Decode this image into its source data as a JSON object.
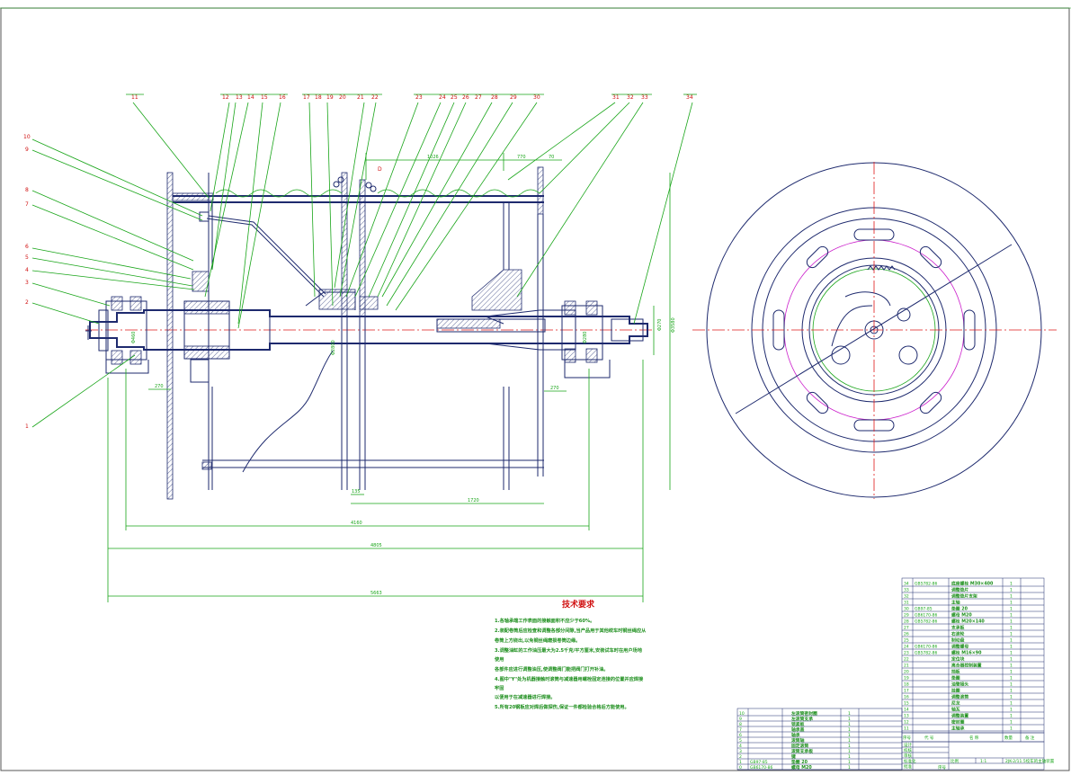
{
  "part_labels": [
    "1",
    "2",
    "3",
    "4",
    "5",
    "6",
    "7",
    "8",
    "9",
    "10",
    "11",
    "12",
    "13",
    "14",
    "15",
    "16",
    "17",
    "18",
    "19",
    "20",
    "21",
    "22",
    "23",
    "24",
    "25",
    "26",
    "27",
    "28",
    "29",
    "30",
    "31",
    "32",
    "33",
    "34"
  ],
  "dimensions": {
    "d_1026": "1026",
    "d_770": "770",
    "d_70": "70",
    "d_270": "270",
    "d_1720": "1720",
    "d_4160": "4160",
    "d_4805": "4805",
    "d_5663": "5663",
    "d_135": "135",
    "phi_3580": "Φ3580",
    "phi_270": "Φ270",
    "phi_2800": "Φ2800",
    "phi_280": "Φ280",
    "phi_460": "Φ460",
    "note_D": "D"
  },
  "tech": {
    "title": "技术要求",
    "lines": [
      "1.各轴承端工作表面的接触面积不应少于60%。",
      "2.装配卷筒后应检查和调整各部分间隙,当产品用于其他绞车时钢丝绳应从",
      "  卷筒上方绕出,以免钢丝绳磨损卷筒边缘。",
      "3.调整油缸的工作油压最大为2.5千克/平方厘米,安装试车时在用户场地",
      "  使用",
      "  各部件应进行调整油压,使调整阀门能把阀门打开补油。",
      "4.图中\"Y\"处为机器接触时滚筒与减速器用螺栓固定连接的位置并应焊接",
      "  牢固",
      "  以便用于在减速器进行焊接。",
      "5.所有20钢板应对焊后做探伤,保证一件都检验合格后方能使用。"
    ]
  },
  "bom_right": [
    {
      "no": "34",
      "std": "GB5782-86",
      "name": "底座螺栓 M30×400",
      "qty": "1"
    },
    {
      "no": "33",
      "std": "",
      "name": "调整垫片",
      "qty": "1"
    },
    {
      "no": "32",
      "std": "",
      "name": "调整垫片支架",
      "qty": "1"
    },
    {
      "no": "31",
      "std": "",
      "name": "主轴",
      "qty": "1"
    },
    {
      "no": "30",
      "std": "GB97-85",
      "name": "垫圈 20",
      "qty": "1"
    },
    {
      "no": "29",
      "std": "GB6170-86",
      "name": "螺母 M20",
      "qty": "1"
    },
    {
      "no": "28",
      "std": "GB5782-86",
      "name": "螺栓 M20×140",
      "qty": "1"
    },
    {
      "no": "27",
      "std": "",
      "name": "支承板",
      "qty": "1"
    },
    {
      "no": "26",
      "std": "",
      "name": "右滚轮",
      "qty": "1"
    },
    {
      "no": "25",
      "std": "",
      "name": "制动盘",
      "qty": "1"
    },
    {
      "no": "24",
      "std": "GB6170-86",
      "name": "调整螺母",
      "qty": "1"
    },
    {
      "no": "23",
      "std": "GB5782-86",
      "name": "螺栓 M16×90",
      "qty": "1"
    },
    {
      "no": "22",
      "std": "",
      "name": "定位块",
      "qty": "1"
    },
    {
      "no": "21",
      "std": "",
      "name": "离合器控制装置",
      "qty": "1"
    },
    {
      "no": "20",
      "std": "",
      "name": "挡板",
      "qty": "1"
    },
    {
      "no": "19",
      "std": "",
      "name": "垫圈",
      "qty": "1"
    },
    {
      "no": "18",
      "std": "",
      "name": "油管接头",
      "qty": "1"
    },
    {
      "no": "17",
      "std": "",
      "name": "挂圈",
      "qty": "1"
    },
    {
      "no": "16",
      "std": "",
      "name": "调整滚筒",
      "qty": "1"
    },
    {
      "no": "15",
      "std": "",
      "name": "尼龙",
      "qty": "1"
    },
    {
      "no": "14",
      "std": "",
      "name": "轴瓦",
      "qty": "1"
    },
    {
      "no": "13",
      "std": "",
      "name": "调整装置",
      "qty": "1"
    },
    {
      "no": "12",
      "std": "",
      "name": "密封圈",
      "qty": "1"
    },
    {
      "no": "11",
      "std": "",
      "name": "主轴承",
      "qty": "1"
    }
  ],
  "bom_right_header": {
    "no": "序号",
    "code": "代 号",
    "name": "名 称",
    "qty": "数量",
    "note": "备 注"
  },
  "title_block": {
    "scale_label": "比例",
    "scale_value": "1:1",
    "drawing_title": "2JK-2/11.5绞车的主轴装置",
    "rows": [
      "设计",
      "校核",
      "审核",
      "标准化",
      "批准"
    ],
    "seq_label": "序号"
  },
  "bom_left": [
    {
      "no": "10",
      "std": "",
      "name": "左滚筒密封圈",
      "qty": "1"
    },
    {
      "no": "9",
      "std": "",
      "name": "左滚筒支承",
      "qty": "1"
    },
    {
      "no": "8",
      "std": "",
      "name": "锁紧板",
      "qty": "1"
    },
    {
      "no": "7",
      "std": "",
      "name": "轴承盖",
      "qty": "1"
    },
    {
      "no": "6",
      "std": "",
      "name": "轴承",
      "qty": "1"
    },
    {
      "no": "5",
      "std": "",
      "name": "滚筒轴",
      "qty": "1"
    },
    {
      "no": "4",
      "std": "",
      "name": "固定滚筒",
      "qty": "1"
    },
    {
      "no": "3",
      "std": "",
      "name": "滚筒支承板",
      "qty": "1"
    },
    {
      "no": "2",
      "std": "",
      "name": "键",
      "qty": "1"
    },
    {
      "no": "1",
      "std": "GB97-85",
      "name": "垫圈 20",
      "qty": "1"
    },
    {
      "no": "0",
      "std": "GB6170-86",
      "name": "螺母 M20",
      "qty": "1"
    }
  ]
}
